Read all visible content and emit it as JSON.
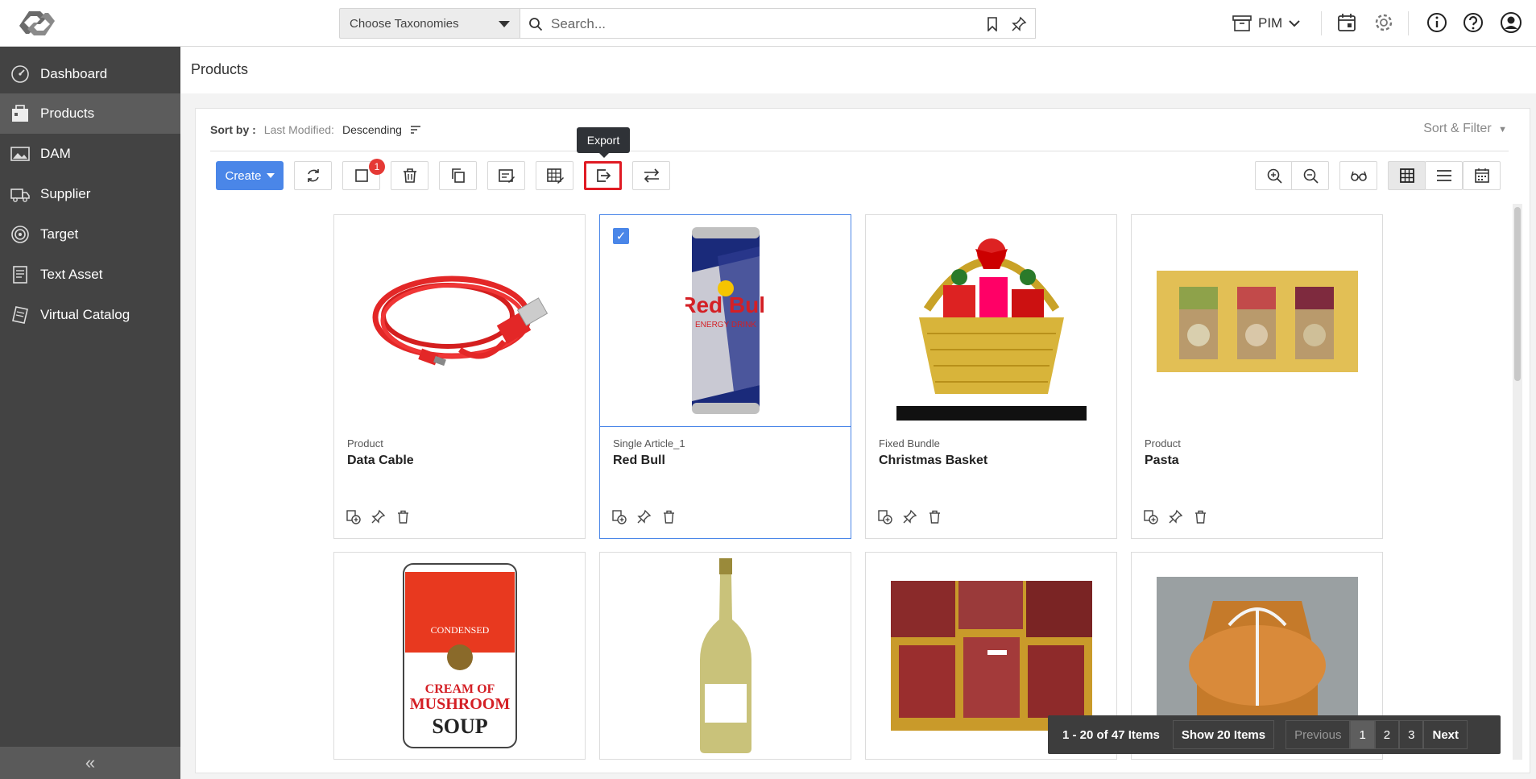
{
  "header": {
    "taxonomy_select": "Choose Taxonomies",
    "search_placeholder": "Search...",
    "module": "PIM"
  },
  "sidebar": {
    "items": [
      {
        "label": "Dashboard",
        "icon": "dashboard-icon"
      },
      {
        "label": "Products",
        "icon": "products-icon",
        "active": true
      },
      {
        "label": "DAM",
        "icon": "image-icon"
      },
      {
        "label": "Supplier",
        "icon": "truck-icon"
      },
      {
        "label": "Target",
        "icon": "target-icon"
      },
      {
        "label": "Text Asset",
        "icon": "document-icon"
      },
      {
        "label": "Virtual Catalog",
        "icon": "catalog-icon"
      }
    ]
  },
  "page": {
    "title": "Products"
  },
  "sort": {
    "label": "Sort by :",
    "field": "Last Modified:",
    "order": "Descending",
    "filter_label": "Sort & Filter"
  },
  "toolbar": {
    "create_label": "Create",
    "selected_count": "1",
    "tooltip": "Export"
  },
  "products": [
    {
      "type": "Product",
      "name": "Data Cable",
      "selected": false
    },
    {
      "type": "Single Article_1",
      "name": "Red Bull",
      "selected": true
    },
    {
      "type": "Fixed Bundle",
      "name": "Christmas Basket",
      "selected": false
    },
    {
      "type": "Product",
      "name": "Pasta",
      "selected": false
    },
    {
      "type": "",
      "name": "",
      "image": "soup-can"
    },
    {
      "type": "",
      "name": "",
      "image": "wine-bottle"
    },
    {
      "type": "",
      "name": "",
      "image": "meat"
    },
    {
      "type": "",
      "name": "",
      "image": "bread"
    }
  ],
  "pager": {
    "range": "1 - 20 of 47 Items",
    "show": "Show 20 Items",
    "previous": "Previous",
    "pages": [
      "1",
      "2",
      "3"
    ],
    "next": "Next",
    "current": "1"
  },
  "colors": {
    "accent": "#4a86e8",
    "sidebar": "#434343",
    "highlight": "#e01b24"
  }
}
